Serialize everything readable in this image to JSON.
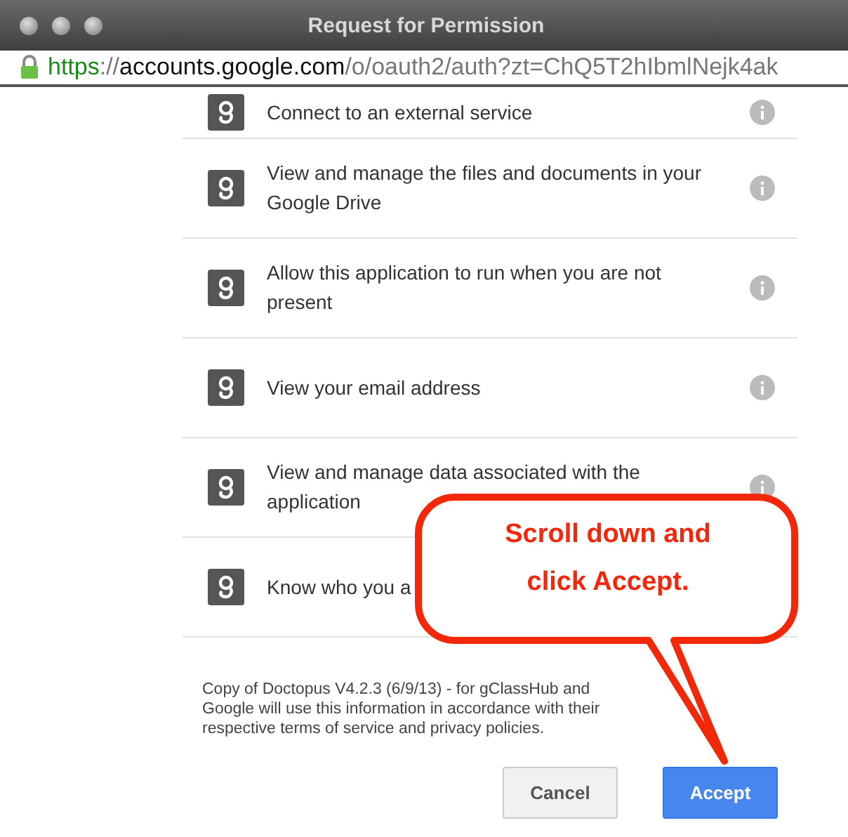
{
  "window": {
    "title": "Request for Permission"
  },
  "address_bar": {
    "scheme": "https",
    "separator": "://",
    "host": "accounts.google.com",
    "path": "/o/oauth2/auth?zt=ChQ5T2hIbmlNejk4ak"
  },
  "permissions": [
    {
      "text": "Connect to an external service"
    },
    {
      "text": "View and manage the files and documents in your Google Drive"
    },
    {
      "text": "Allow this application to run when you are not present"
    },
    {
      "text": "View your email address"
    },
    {
      "text": "View and manage data associated with the application"
    },
    {
      "text": "Know who you a"
    }
  ],
  "disclaimer": "Copy of Doctopus V4.2.3 (6/9/13) - for gClassHub and Google will use this information in accordance with their respective terms of service and privacy policies.",
  "buttons": [
    {
      "label": "Cancel",
      "kind": "secondary"
    },
    {
      "label": "Accept",
      "kind": "primary"
    }
  ],
  "callout": {
    "lines": [
      "Scroll down and",
      "click Accept."
    ]
  }
}
